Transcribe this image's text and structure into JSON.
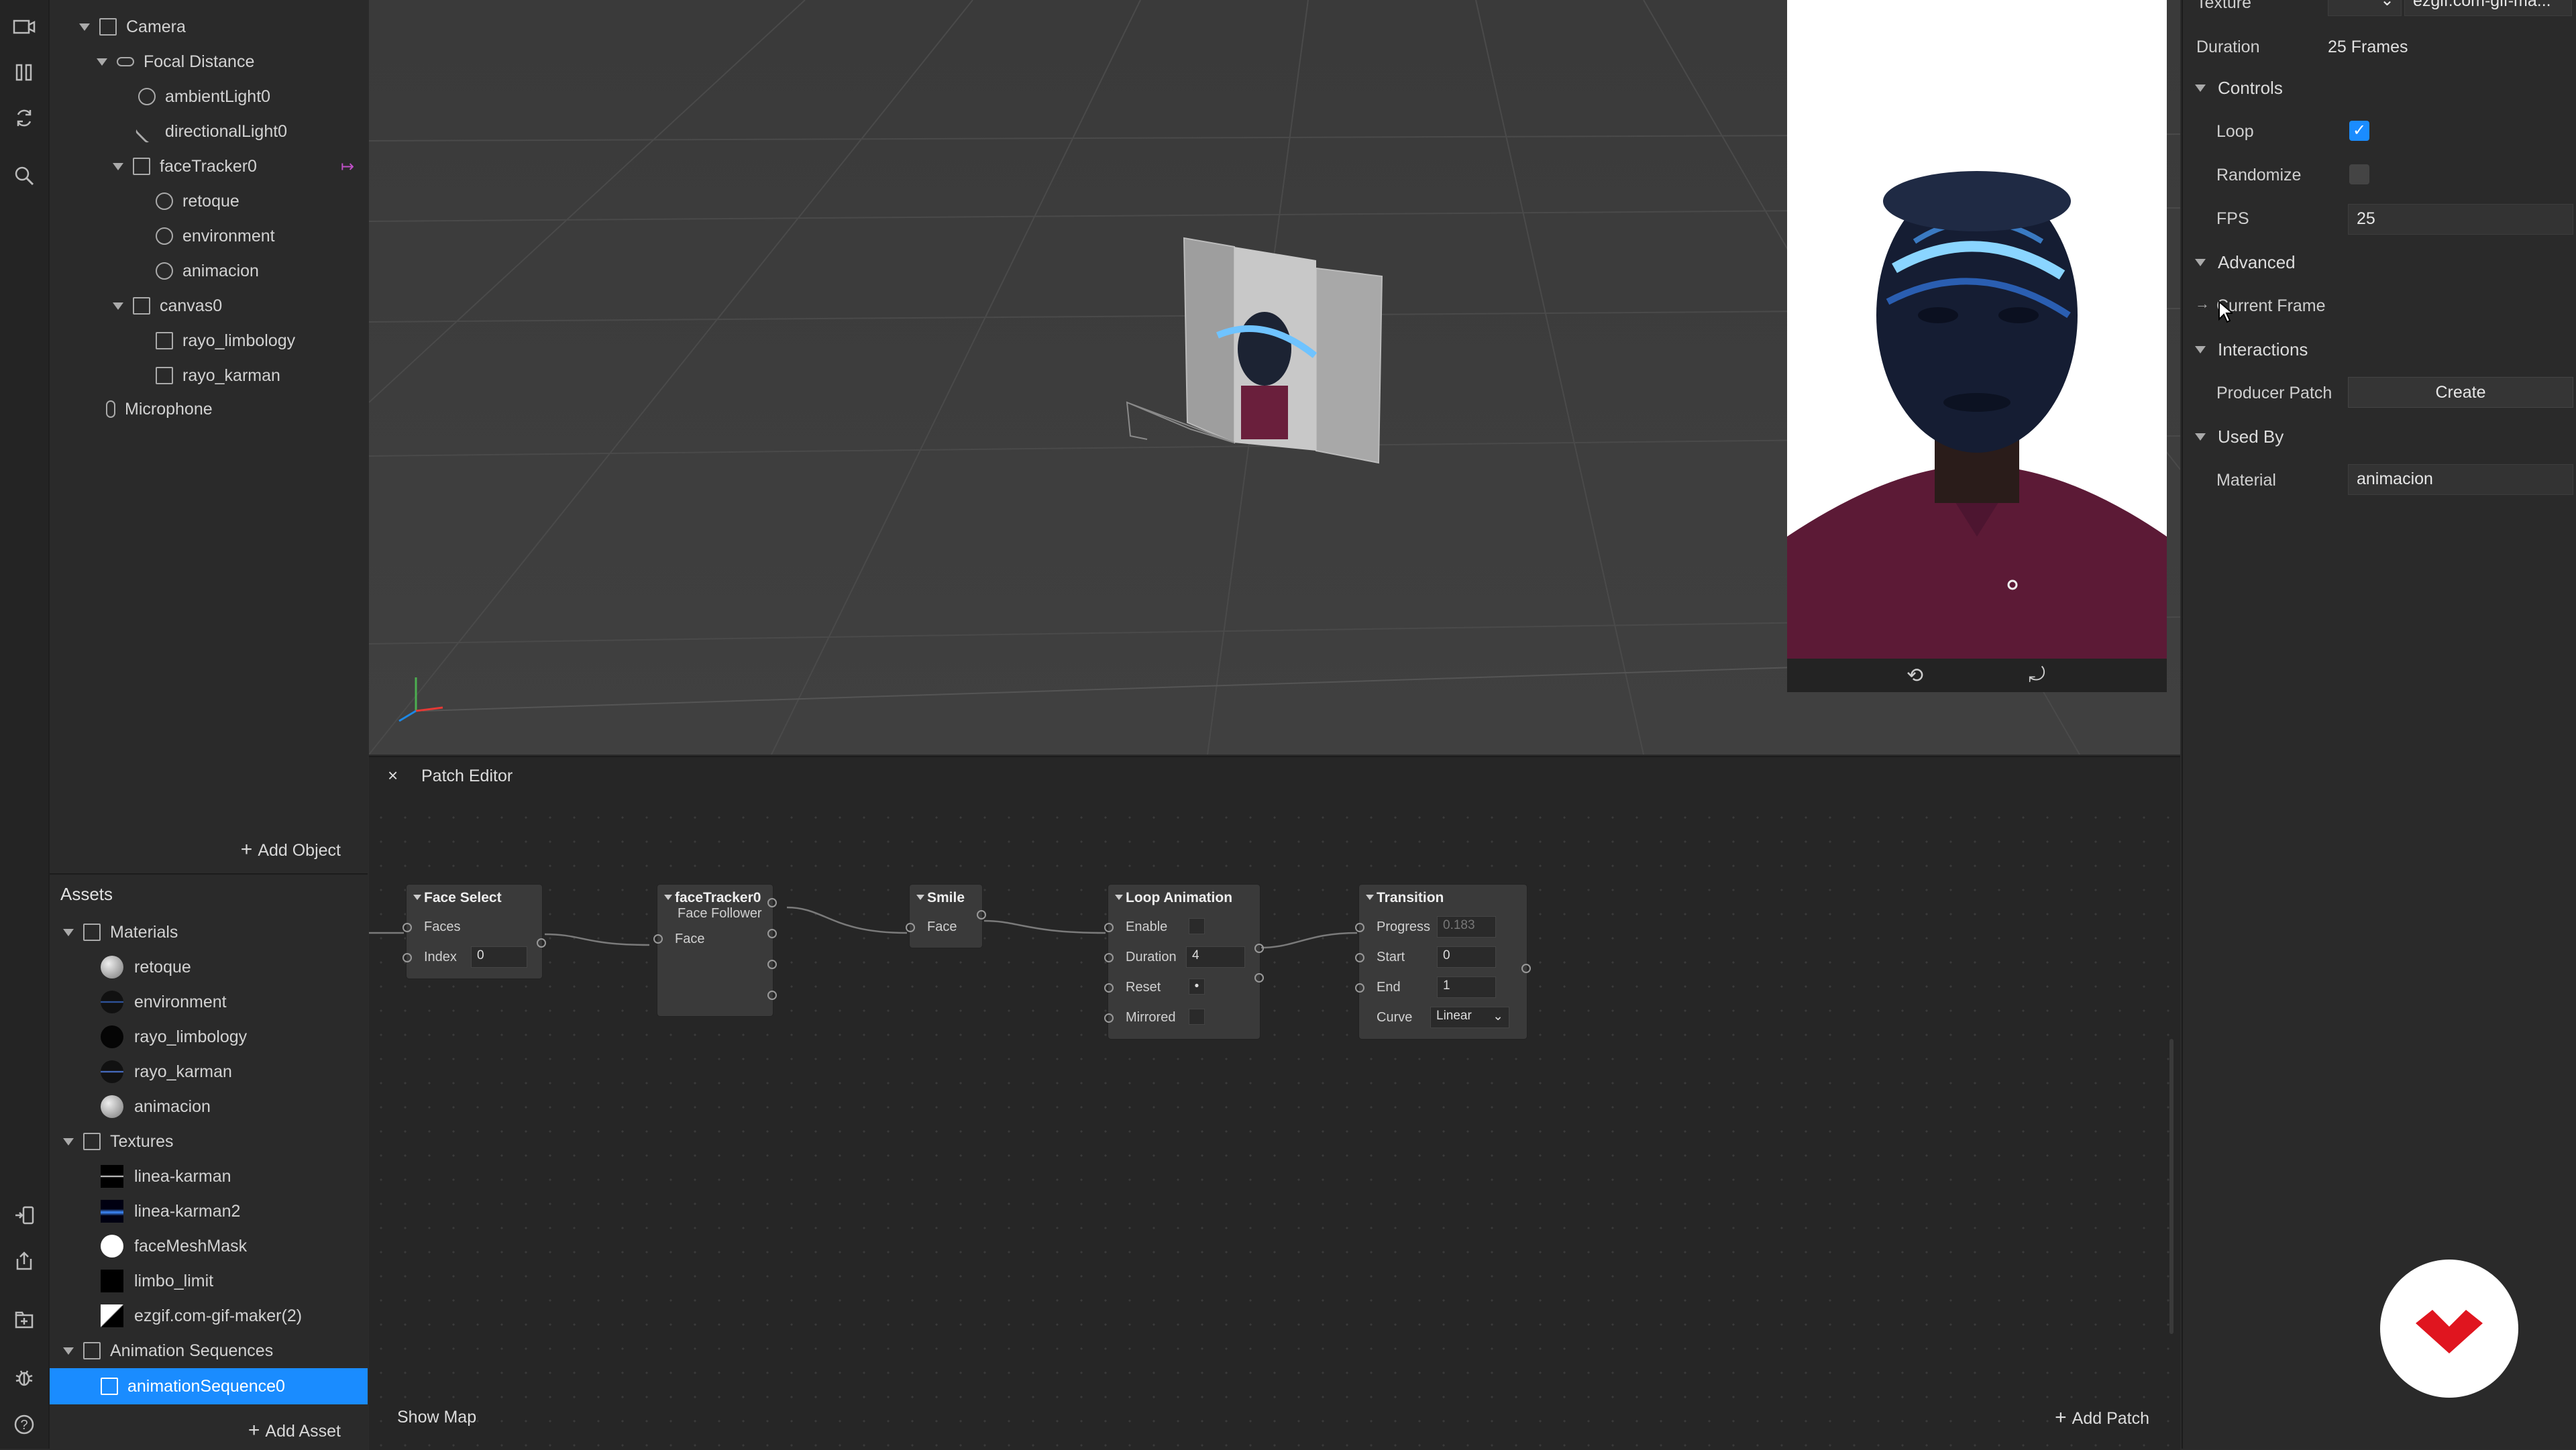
{
  "scene": {
    "items": [
      {
        "label": "Camera",
        "indent": 0,
        "icon": "camera-icon"
      },
      {
        "label": "Focal Distance",
        "indent": 1,
        "icon": "focal-icon"
      },
      {
        "label": "ambientLight0",
        "indent": 2,
        "icon": "ambient-light-icon"
      },
      {
        "label": "directionalLight0",
        "indent": 2,
        "icon": "directional-light-icon"
      },
      {
        "label": "faceTracker0",
        "indent": 2,
        "icon": "face-tracker-icon"
      },
      {
        "label": "retoque",
        "indent": 3,
        "icon": "mesh-icon"
      },
      {
        "label": "environment",
        "indent": 3,
        "icon": "mesh-icon"
      },
      {
        "label": "animacion",
        "indent": 3,
        "icon": "mesh-icon"
      },
      {
        "label": "canvas0",
        "indent": 2,
        "icon": "canvas-icon"
      },
      {
        "label": "rayo_limbology",
        "indent": 3,
        "icon": "rectangle-icon"
      },
      {
        "label": "rayo_karman",
        "indent": 3,
        "icon": "rectangle-icon"
      },
      {
        "label": "Microphone",
        "indent": 1,
        "icon": "microphone-icon"
      }
    ],
    "add_object": "Add Object"
  },
  "assets": {
    "title": "Assets",
    "materials_label": "Materials",
    "materials": [
      "retoque",
      "environment",
      "rayo_limbology",
      "rayo_karman",
      "animacion"
    ],
    "textures_label": "Textures",
    "textures": [
      "linea-karman",
      "linea-karman2",
      "faceMeshMask",
      "limbo_limit",
      "ezgif.com-gif-maker(2)"
    ],
    "sequences_label": "Animation Sequences",
    "sequences": [
      "animationSequence0"
    ],
    "add_asset": "Add Asset"
  },
  "patch_editor": {
    "title": "Patch Editor",
    "show_map": "Show Map",
    "add_patch": "Add Patch",
    "nodes": {
      "face_select": {
        "title": "Face Select",
        "faces": "Faces",
        "index": "Index",
        "index_value": "0"
      },
      "face_tracker": {
        "title": "faceTracker0",
        "subtitle": "Face Follower",
        "face": "Face"
      },
      "smile": {
        "title": "Smile",
        "face": "Face"
      },
      "loop_animation": {
        "title": "Loop Animation",
        "enable": "Enable",
        "duration": "Duration",
        "duration_value": "4",
        "reset": "Reset",
        "mirrored": "Mirrored"
      },
      "transition": {
        "title": "Transition",
        "progress": "Progress",
        "progress_value": "0.183",
        "start": "Start",
        "start_value": "0",
        "end": "End",
        "end_value": "1",
        "curve": "Curve",
        "curve_value": "Linear"
      }
    }
  },
  "inspector": {
    "texture_label": "Texture",
    "texture_value": "ezgif.com-gif-ma...",
    "duration_label": "Duration",
    "duration_value": "25 Frames",
    "controls": "Controls",
    "loop": "Loop",
    "loop_checked": true,
    "randomize": "Randomize",
    "fps_label": "FPS",
    "fps_value": "25",
    "advanced": "Advanced",
    "current_frame": "Current Frame",
    "interactions": "Interactions",
    "producer_patch": "Producer Patch",
    "create": "Create",
    "used_by": "Used By",
    "material_label": "Material",
    "material_value": "animacion"
  },
  "colors": {
    "accent": "#1a8cff",
    "logo_red": "#e0151f"
  }
}
